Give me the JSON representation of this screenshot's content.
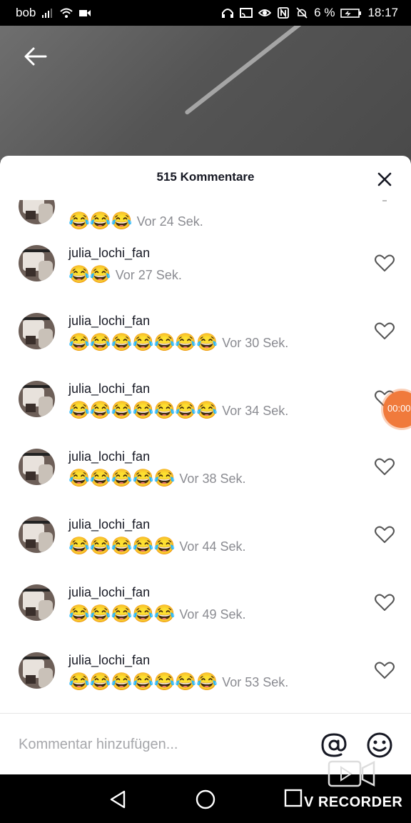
{
  "status_bar": {
    "carrier": "bob",
    "battery": "6 %",
    "time": "18:17"
  },
  "header": {
    "back_icon": "arrow-left-icon",
    "title": "515 Kommentare",
    "close_icon": "close-icon"
  },
  "comments": [
    {
      "username": "",
      "emojis": "😂😂😂",
      "time": "Vor 24 Sek.",
      "partial": true
    },
    {
      "username": "julia_lochi_fan",
      "emojis": "😂😂",
      "time": "Vor 27 Sek."
    },
    {
      "username": "julia_lochi_fan",
      "emojis": "😂😂😂😂😂😂😂",
      "time": "Vor 30 Sek."
    },
    {
      "username": "julia_lochi_fan",
      "emojis": "😂😂😂😂😂😂😂",
      "time": "Vor 34 Sek."
    },
    {
      "username": "julia_lochi_fan",
      "emojis": "😂😂😂😂😂",
      "time": "Vor 38 Sek."
    },
    {
      "username": "julia_lochi_fan",
      "emojis": "😂😂😂😂😂",
      "time": "Vor 44 Sek."
    },
    {
      "username": "julia_lochi_fan",
      "emojis": "😂😂😂😂😂",
      "time": "Vor 49 Sek."
    },
    {
      "username": "julia_lochi_fan",
      "emojis": "😂😂😂😂😂😂😂",
      "time": "Vor 53 Sek."
    }
  ],
  "input": {
    "placeholder": "Kommentar hinzufügen...",
    "at_icon": "at-sign-icon",
    "emoji_icon": "smiley-icon"
  },
  "overlay": {
    "recorder_label": "V RECORDER",
    "recorder_timer": "00:00"
  },
  "colors": {
    "sheet_bg": "#ffffff",
    "username": "#161823",
    "timestamp": "#8a8b91",
    "recorder_bubble": "#f07a3c"
  }
}
